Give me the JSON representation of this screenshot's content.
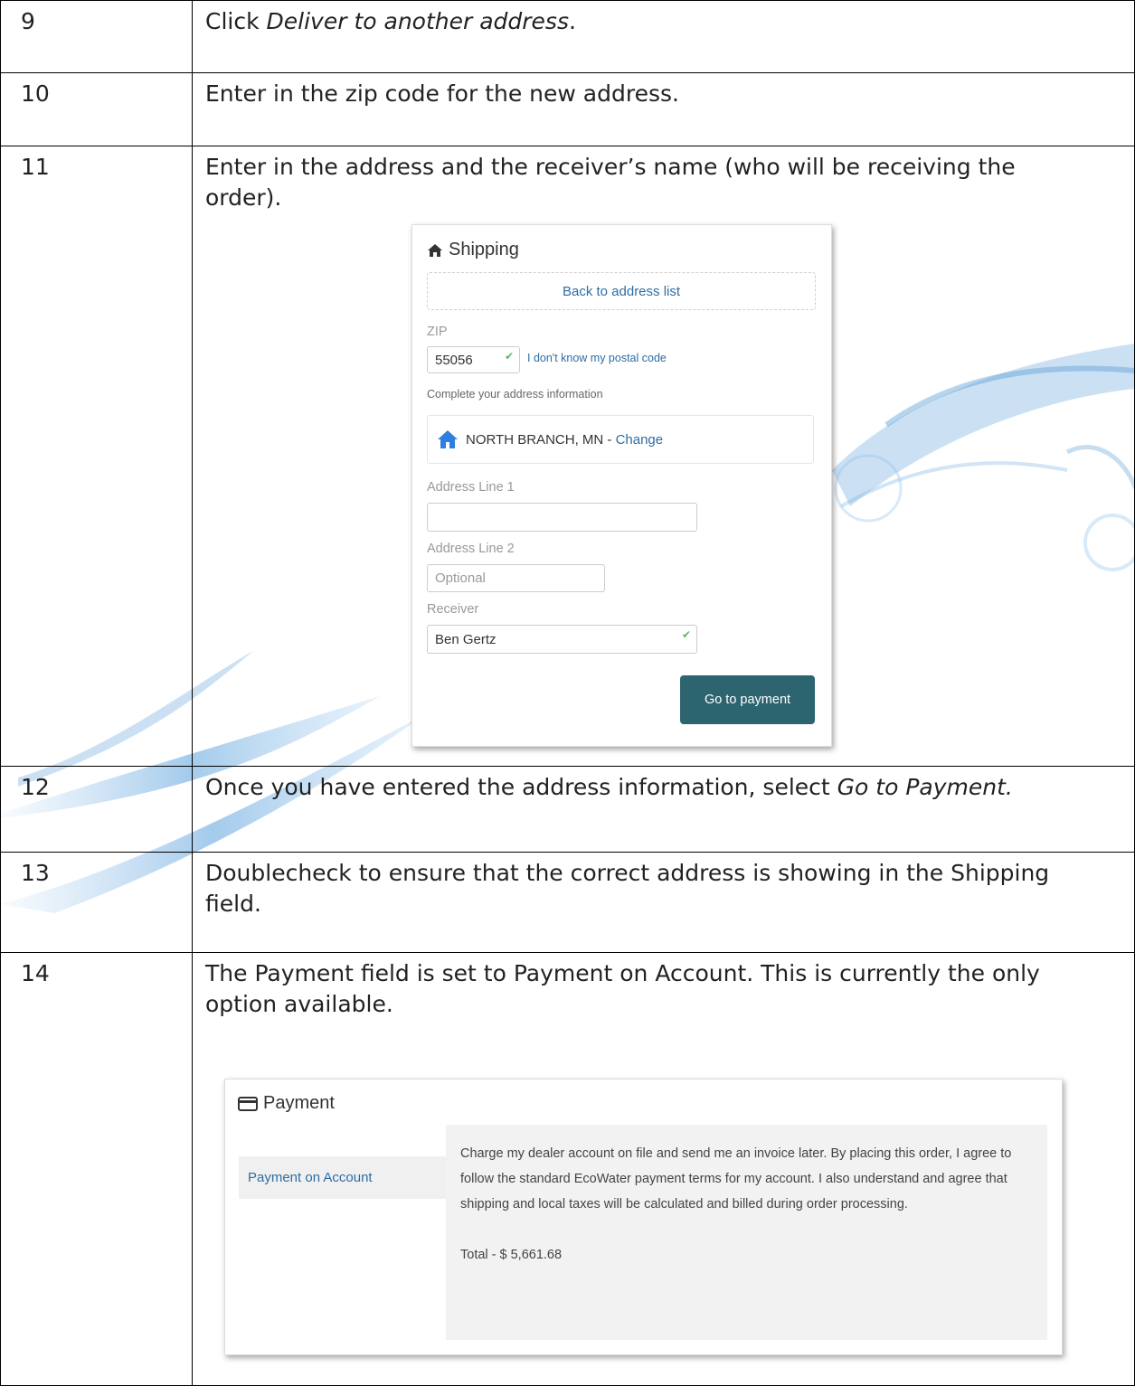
{
  "steps": [
    {
      "num": "9",
      "text_before": "Click ",
      "text_em": "Deliver to another address",
      "text_after": "."
    },
    {
      "num": "10",
      "text": "Enter in the zip code for the new address."
    },
    {
      "num": "11",
      "text": "Enter in the address and the receiver’s name (who will be receiving the order)."
    },
    {
      "num": "12",
      "text_before": "Once you have entered the address information, select ",
      "text_em": "Go to Payment."
    },
    {
      "num": "13",
      "text": "Doublecheck to ensure that the correct address is showing in the Shipping field."
    },
    {
      "num": "14",
      "text": "The Payment field is set to Payment on Account. This is currently the only option available."
    }
  ],
  "shipping": {
    "title": "Shipping",
    "back_link": "Back to address list",
    "zip_label": "ZIP",
    "zip_value": "55056",
    "zip_help_link": "I don't know my postal code",
    "complete_hint": "Complete your address information",
    "city_text": "NORTH BRANCH, MN - ",
    "city_change_link": "Change",
    "address1_label": "Address Line 1",
    "address1_value": "",
    "address2_label": "Address Line 2",
    "address2_placeholder": "Optional",
    "receiver_label": "Receiver",
    "receiver_value": "Ben Gertz",
    "go_to_payment": "Go to payment"
  },
  "payment": {
    "title": "Payment",
    "method": "Payment on Account",
    "description": "Charge my dealer account on file and send me an invoice later. By placing this order, I agree to follow the standard EcoWater payment terms for my account. I also understand and agree that shipping and local taxes will be calculated and billed during order processing.",
    "total": "Total - $ 5,661.68"
  },
  "colors": {
    "link": "#2e6da4",
    "button": "#2c6470",
    "check": "#5cb85c",
    "house_icon": "#2f7fe0"
  },
  "icons": {
    "shipping": "home-icon",
    "city": "house-icon",
    "payment": "credit-card-icon",
    "validated": "checkmark-icon"
  }
}
